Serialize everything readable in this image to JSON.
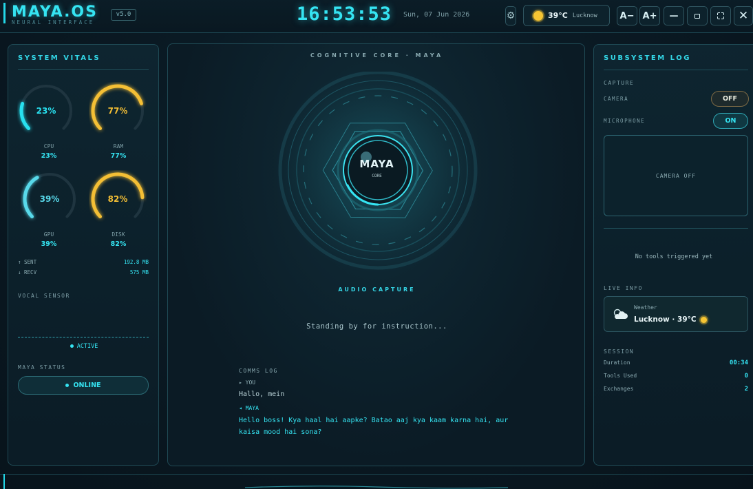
{
  "header": {
    "brand_name": "MAYA.OS",
    "brand_subtitle": "NEURAL INTERFACE",
    "version": "v5.0",
    "clock": "16:53:53",
    "date": "Sun, 07 Jun 2026",
    "settings_icon": "⚙",
    "weather_temp": "39°C",
    "weather_city": "Lucknow",
    "font_decrease_label": "A−",
    "font_increase_label": "A+",
    "minimize_label": "—",
    "close_label": "✕"
  },
  "left_panel": {
    "title": "SYSTEM VITALS",
    "gauges": [
      {
        "name": "CPU",
        "percent": 23,
        "label": "23%",
        "color": "#28e0ef"
      },
      {
        "name": "RAM",
        "percent": 77,
        "label": "77%",
        "color": "#f4bf35"
      },
      {
        "name": "GPU",
        "percent": 39,
        "label": "39%",
        "color": "#58d9ea"
      },
      {
        "name": "DISK",
        "percent": 82,
        "label": "82%",
        "color": "#f4bf35"
      }
    ],
    "network": {
      "sent_label": "↑ SENT",
      "sent_value": "192.8 MB",
      "recv_label": "↓ RECV",
      "recv_value": "575 MB"
    },
    "vocal_sensor_label": "VOCAL SENSOR",
    "vocal_state": "ACTIVE",
    "status_label": "MAYA STATUS",
    "status_value": "ONLINE"
  },
  "center_panel": {
    "title": "COGNITIVE CORE · MAYA",
    "core_name": "MAYA",
    "core_sub": "CORE",
    "audio_label": "AUDIO CAPTURE",
    "standby_text": "Standing by for instruction...",
    "comms_label": "COMMS LOG",
    "you_tag": "▸ YOU",
    "you_message": "Hallo, mein",
    "maya_tag": "◂ MAYA",
    "maya_message": "Hello boss! Kya haal hai aapke? Batao aaj kya kaam karna hai, aur kaisa mood hai sona?"
  },
  "right_panel": {
    "title": "SUBSYSTEM LOG",
    "capture_label": "CAPTURE",
    "camera_label": "CAMERA",
    "camera_toggle": "OFF",
    "mic_label": "MICROPHONE",
    "mic_toggle": "ON",
    "camera_view_text": "CAMERA OFF",
    "tools_empty": "No tools triggered yet",
    "live_info_label": "LIVE INFO",
    "live_card_label": "Weather",
    "live_card_value": "Lucknow · 39°C",
    "session_label": "SESSION",
    "session": [
      {
        "label": "Duration",
        "value": "00:34"
      },
      {
        "label": "Tools Used",
        "value": "0"
      },
      {
        "label": "Exchanges",
        "value": "2"
      }
    ]
  },
  "colors": {
    "accent": "#35e4f2",
    "warm": "#f4bf35",
    "panel_border": "#1f4a55"
  }
}
